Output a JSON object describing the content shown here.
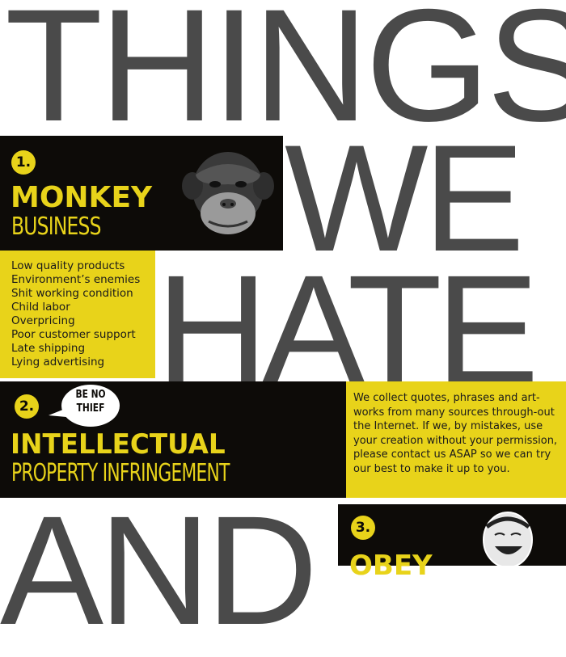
{
  "headline": {
    "things": "THINGS",
    "we": "WE",
    "hate": "HATE",
    "and": "AND"
  },
  "section1": {
    "number": "1.",
    "title_bold": "MONKEY",
    "title_thin": "BUSINESS",
    "items": [
      "Low quality products",
      "Environment’s enemies",
      "Shit  working condition",
      "Child labor",
      "Overpricing",
      "Poor customer support",
      "Late shipping",
      "Lying advertising"
    ]
  },
  "section2": {
    "number": "2.",
    "bubble_line1": "BE NO",
    "bubble_line2": "THIEF",
    "title_bold": "INTELLECTUAL",
    "title_thin": "PROPERTY INFRINGEMENT",
    "paragraph": "We collect quotes, phrases and art-works from many sources through-out the Internet. If we, by mistakes, use your creation without your permission, please contact us ASAP so we can try our best to make it up to you."
  },
  "section3": {
    "number": "3.",
    "title_bold": "OBEY"
  },
  "colors": {
    "yellow": "#e8d31a",
    "black": "#0d0b08",
    "gray": "#4a4a4a"
  }
}
